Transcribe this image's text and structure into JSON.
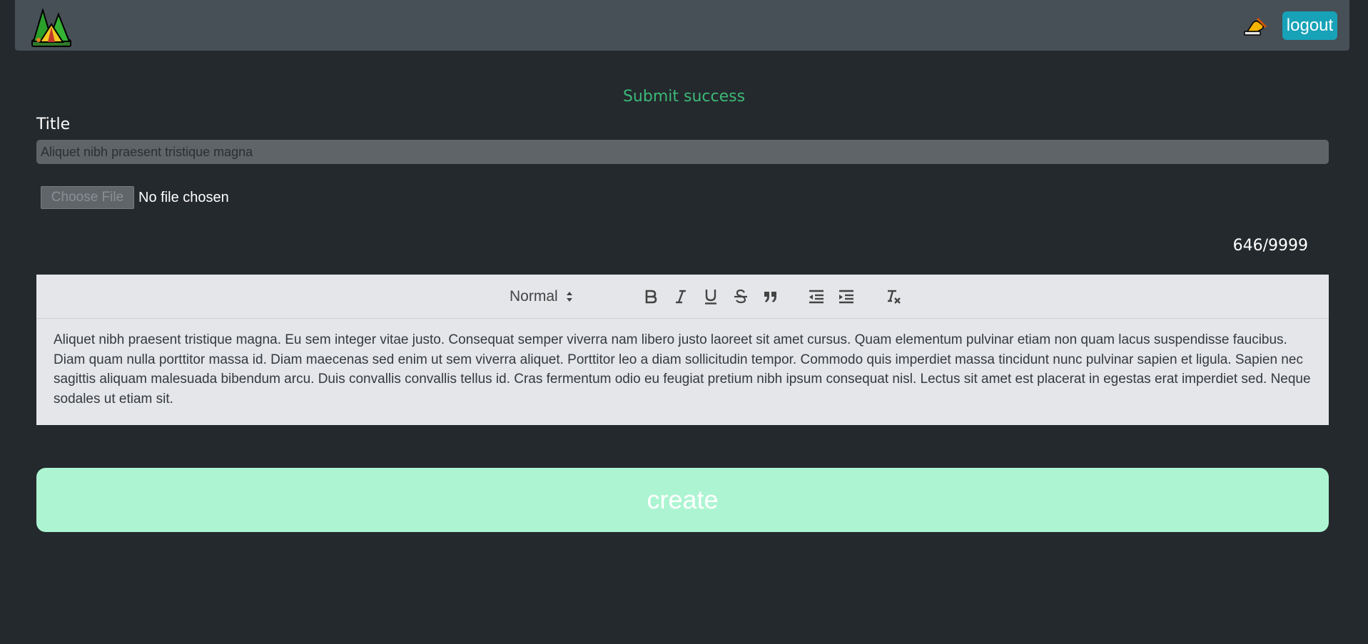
{
  "navbar": {
    "logo_icon": "camping-tent-trees-icon",
    "write_icon": "writing-hand-icon",
    "logout_label": "logout",
    "logout_color": "#17a2b8"
  },
  "status_message": "Submit success",
  "form": {
    "title_label": "Title",
    "title_value": "Aliquet nibh praesent tristique magna",
    "file_button_label": "Choose File",
    "file_status": "No file chosen",
    "char_counter": "646/9999"
  },
  "editor": {
    "toolbar": {
      "header_select_value": "Normal",
      "buttons": [
        "bold-icon",
        "italic-icon",
        "underline-icon",
        "strikethrough-icon",
        "blockquote-icon",
        "outdent-icon",
        "indent-icon",
        "clear-format-icon"
      ]
    },
    "content": "Aliquet nibh praesent tristique magna. Eu sem integer vitae justo. Consequat semper viverra nam libero justo laoreet sit amet cursus. Quam elementum pulvinar etiam non quam lacus suspendisse faucibus. Diam quam nulla porttitor massa id. Diam maecenas sed enim ut sem viverra aliquet. Porttitor leo a diam sollicitudin tempor. Commodo quis imperdiet massa tincidunt nunc pulvinar sapien et ligula. Sapien nec sagittis aliquam malesuada bibendum arcu. Duis convallis convallis tellus id. Cras fermentum odio eu feugiat pretium nibh ipsum consequat nisl. Lectus sit amet est placerat in egestas erat imperdiet sed. Neque sodales ut etiam sit."
  },
  "submit": {
    "create_label": "create",
    "create_color": "#adf5d2"
  }
}
